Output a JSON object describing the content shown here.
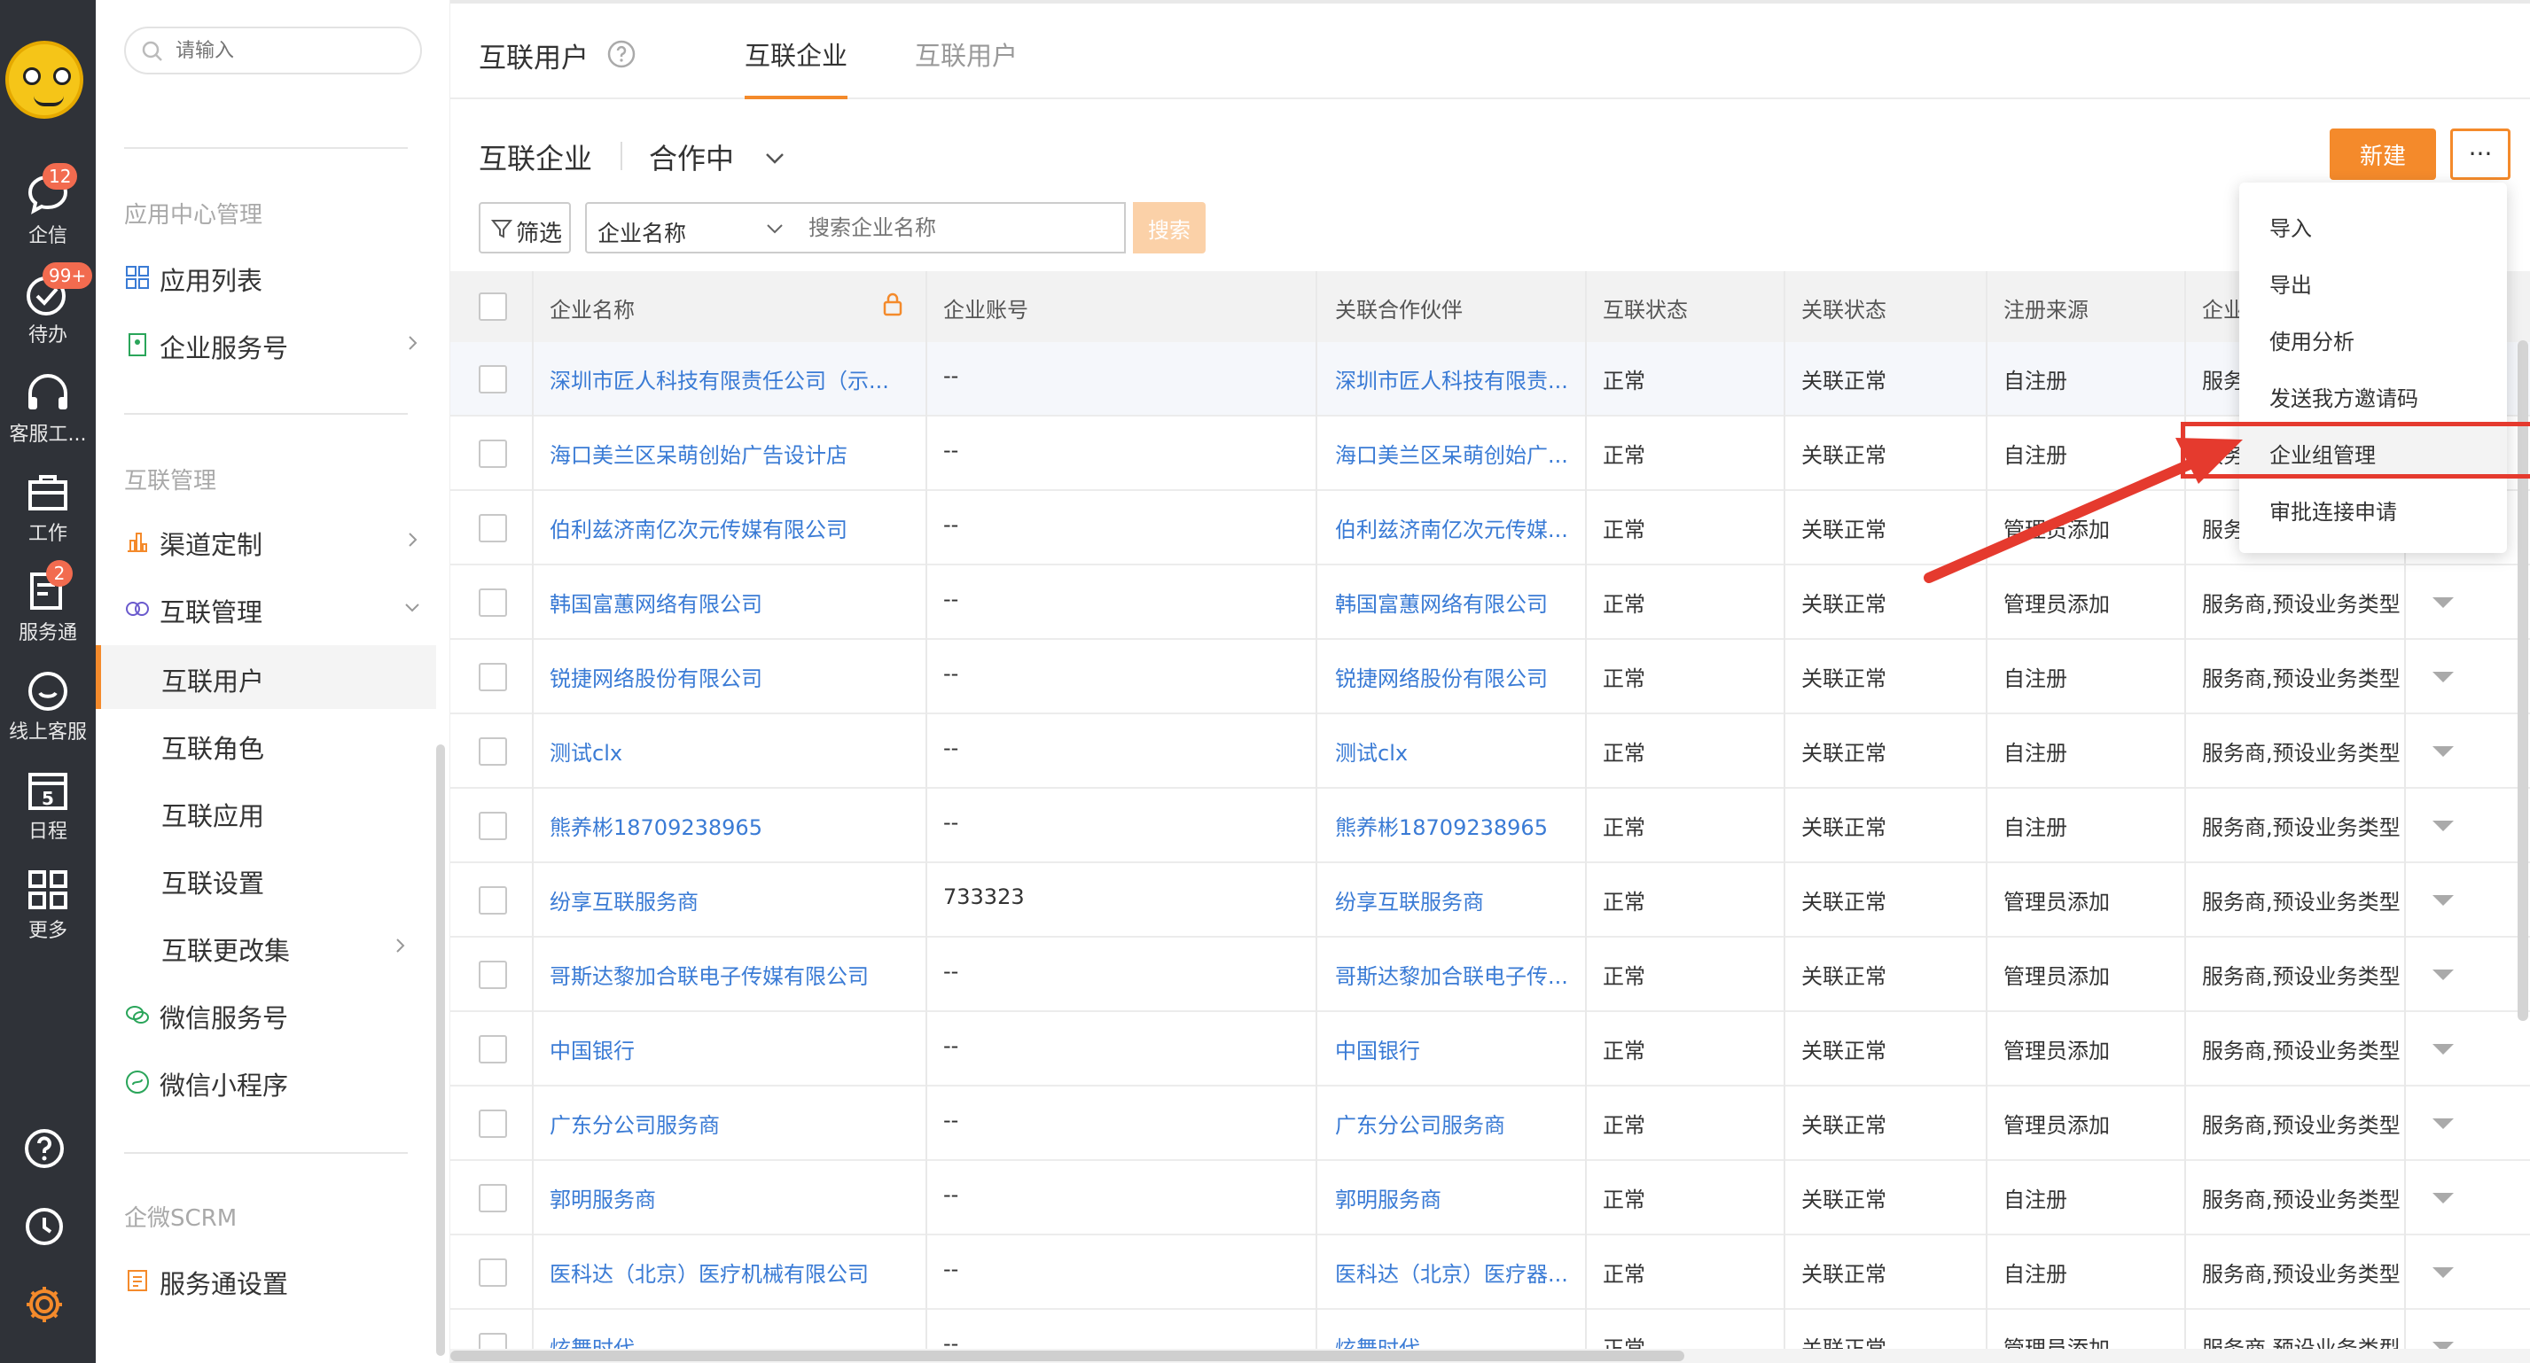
{
  "rail": {
    "items": [
      {
        "label": "企信",
        "icon": "chat-bubble-icon",
        "badge": "12"
      },
      {
        "label": "待办",
        "icon": "check-circle-icon",
        "badge": "99+"
      },
      {
        "label": "客服工...",
        "icon": "headset-icon",
        "badge": ""
      },
      {
        "label": "工作",
        "icon": "briefcase-icon",
        "badge": ""
      },
      {
        "label": "服务通",
        "icon": "service-icon",
        "badge": "2"
      },
      {
        "label": "线上客服",
        "icon": "smile-chat-icon",
        "badge": ""
      },
      {
        "label": "日程",
        "icon": "calendar-icon",
        "badge": "",
        "day": "5"
      },
      {
        "label": "更多",
        "icon": "grid-icon",
        "badge": ""
      }
    ]
  },
  "sidebar": {
    "search_placeholder": "请输入",
    "sections": [
      "应用中心管理",
      "互联管理",
      "企微SCRM"
    ],
    "items": [
      {
        "label": "应用列表"
      },
      {
        "label": "企业服务号"
      },
      {
        "label": "渠道定制"
      },
      {
        "label": "互联管理"
      },
      {
        "label": "互联用户"
      },
      {
        "label": "互联角色"
      },
      {
        "label": "互联应用"
      },
      {
        "label": "互联设置"
      },
      {
        "label": "互联更改集"
      },
      {
        "label": "微信服务号"
      },
      {
        "label": "微信小程序"
      },
      {
        "label": "服务通设置"
      }
    ]
  },
  "header": {
    "title": "互联用户",
    "tabs": [
      {
        "label": "互联企业"
      },
      {
        "label": "互联用户"
      }
    ]
  },
  "toolbar": {
    "heading": "互联企业",
    "status": "合作中",
    "new_label": "新建",
    "more_label": "···",
    "filter_label": "筛选",
    "field_select": "企业名称",
    "search_placeholder": "搜索企业名称",
    "search_label": "搜索"
  },
  "table": {
    "columns": [
      "企业名称",
      "企业账号",
      "关联合作伙伴",
      "互联状态",
      "关联状态",
      "注册来源",
      "企业"
    ],
    "rows": [
      [
        "深圳市匠人科技有限责任公司（示...",
        "--",
        "深圳市匠人科技有限责...",
        "正常",
        "关联正常",
        "自注册",
        "服务"
      ],
      [
        "海口美兰区呆萌创始广告设计店",
        "--",
        "海口美兰区呆萌创始广...",
        "正常",
        "关联正常",
        "自注册",
        "服务"
      ],
      [
        "伯利兹济南亿次元传媒有限公司",
        "--",
        "伯利兹济南亿次元传媒...",
        "正常",
        "关联正常",
        "管理员添加",
        "服务"
      ],
      [
        "韩国富蕙网络有限公司",
        "--",
        "韩国富蕙网络有限公司",
        "正常",
        "关联正常",
        "管理员添加",
        "服务商,预设业务类型"
      ],
      [
        "锐捷网络股份有限公司",
        "--",
        "锐捷网络股份有限公司",
        "正常",
        "关联正常",
        "自注册",
        "服务商,预设业务类型"
      ],
      [
        "测试clx",
        "--",
        "测试clx",
        "正常",
        "关联正常",
        "自注册",
        "服务商,预设业务类型"
      ],
      [
        "熊养彬18709238965",
        "--",
        "熊养彬18709238965",
        "正常",
        "关联正常",
        "自注册",
        "服务商,预设业务类型"
      ],
      [
        "纷享互联服务商",
        "733323",
        "纷享互联服务商",
        "正常",
        "关联正常",
        "管理员添加",
        "服务商,预设业务类型"
      ],
      [
        "哥斯达黎加合联电子传媒有限公司",
        "--",
        "哥斯达黎加合联电子传...",
        "正常",
        "关联正常",
        "管理员添加",
        "服务商,预设业务类型"
      ],
      [
        "中国银行",
        "--",
        "中国银行",
        "正常",
        "关联正常",
        "管理员添加",
        "服务商,预设业务类型"
      ],
      [
        "广东分公司服务商",
        "--",
        "广东分公司服务商",
        "正常",
        "关联正常",
        "管理员添加",
        "服务商,预设业务类型"
      ],
      [
        "郭明服务商",
        "--",
        "郭明服务商",
        "正常",
        "关联正常",
        "自注册",
        "服务商,预设业务类型"
      ],
      [
        "医科达（北京）医疗机械有限公司",
        "--",
        "医科达（北京）医疗器...",
        "正常",
        "关联正常",
        "自注册",
        "服务商,预设业务类型"
      ],
      [
        "炫舞时代",
        "--",
        "炫舞时代",
        "正常",
        "关联正常",
        "管理员添加",
        "服务商,预设业务类型"
      ]
    ]
  },
  "dropdown": {
    "items": [
      "导入",
      "导出",
      "使用分析",
      "发送我方邀请码",
      "企业组管理",
      "审批连接申请"
    ]
  },
  "colors": {
    "accent": "#f48a2b",
    "link": "#3a7bd5",
    "rail": "#2f3238",
    "annotation": "#e53a2e"
  }
}
